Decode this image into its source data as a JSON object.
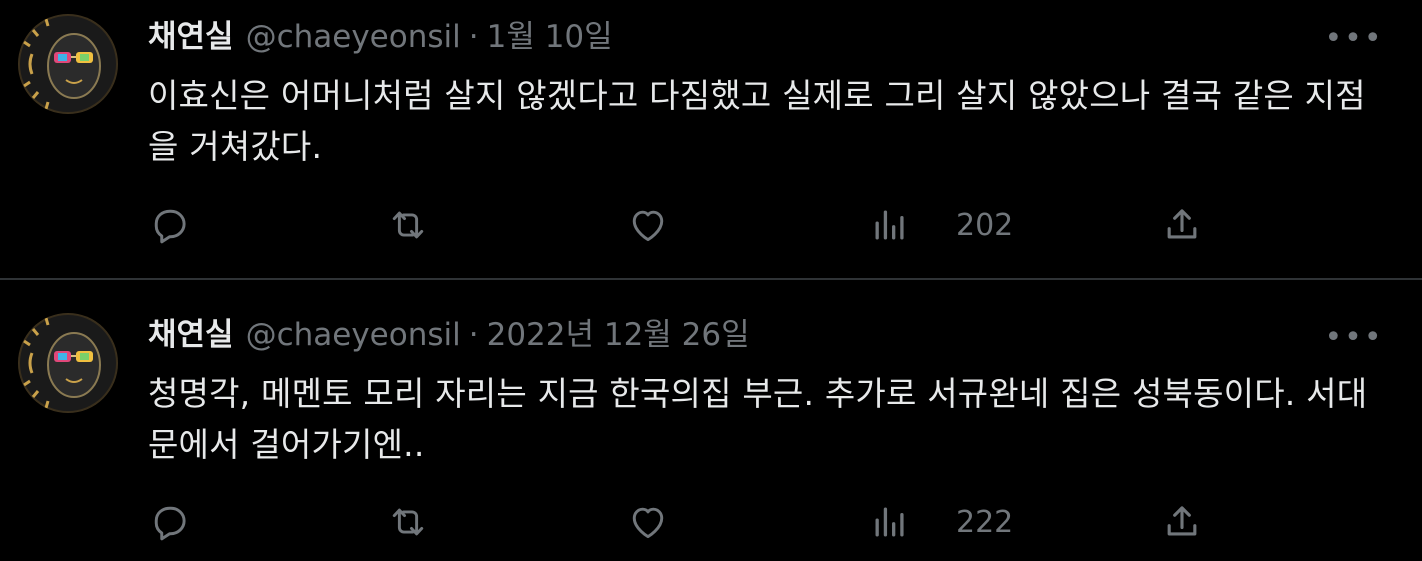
{
  "colors": {
    "background": "#000000",
    "primary_text": "#e7e9ea",
    "secondary_text": "#71767b",
    "divider": "#2f3336"
  },
  "tweets": [
    {
      "author_name": "채연실",
      "handle": "@chaeyeonsil",
      "separator": "·",
      "date": "1월 10일",
      "more_label": "•••",
      "text": "이효신은 어머니처럼 살지 않겠다고 다짐했고 실제로 그리 살지 않았으나 결국 같은 지점을 거쳐갔다.",
      "actions": {
        "reply_icon": "reply-icon",
        "retweet_icon": "retweet-icon",
        "like_icon": "heart-icon",
        "views_icon": "views-chart-icon",
        "views_count": "202",
        "share_icon": "share-icon"
      }
    },
    {
      "author_name": "채연실",
      "handle": "@chaeyeonsil",
      "separator": "·",
      "date": "2022년 12월 26일",
      "more_label": "•••",
      "text": "청명각, 메멘토 모리 자리는 지금 한국의집 부근. 추가로 서규완네 집은 성북동이다. 서대문에서 걸어가기엔..",
      "actions": {
        "reply_icon": "reply-icon",
        "retweet_icon": "retweet-icon",
        "like_icon": "heart-icon",
        "views_icon": "views-chart-icon",
        "views_count": "222",
        "share_icon": "share-icon"
      }
    }
  ]
}
